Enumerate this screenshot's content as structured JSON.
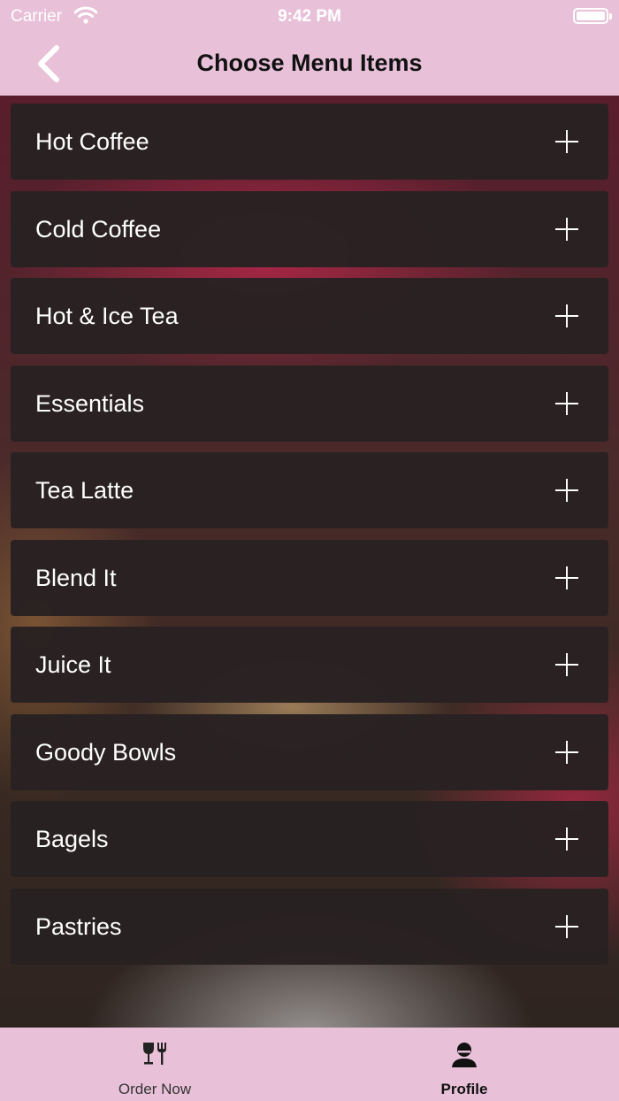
{
  "status_bar": {
    "carrier": "Carrier",
    "time": "9:42 PM",
    "icons": [
      "wifi-icon",
      "battery-icon"
    ]
  },
  "nav": {
    "back_icon": "chevron-left-icon",
    "title": "Choose Menu Items"
  },
  "menu": {
    "items": [
      {
        "label": "Hot Coffee",
        "icon": "plus-icon"
      },
      {
        "label": "Cold Coffee",
        "icon": "plus-icon"
      },
      {
        "label": "Hot & Ice Tea",
        "icon": "plus-icon"
      },
      {
        "label": "Essentials",
        "icon": "plus-icon"
      },
      {
        "label": "Tea Latte",
        "icon": "plus-icon"
      },
      {
        "label": "Blend It",
        "icon": "plus-icon"
      },
      {
        "label": "Juice It",
        "icon": "plus-icon"
      },
      {
        "label": "Goody Bowls",
        "icon": "plus-icon"
      },
      {
        "label": "Bagels",
        "icon": "plus-icon"
      },
      {
        "label": "Pastries",
        "icon": "plus-icon"
      }
    ]
  },
  "tab_bar": {
    "tabs": [
      {
        "label": "Order Now",
        "icon": "glass-fork-icon",
        "selected": false
      },
      {
        "label": "Profile",
        "icon": "person-icon",
        "selected": true
      }
    ]
  },
  "colors": {
    "bar_background": "#e8c1d9",
    "item_background": "#282122",
    "item_text": "#ffffff",
    "title_text": "#111111"
  }
}
